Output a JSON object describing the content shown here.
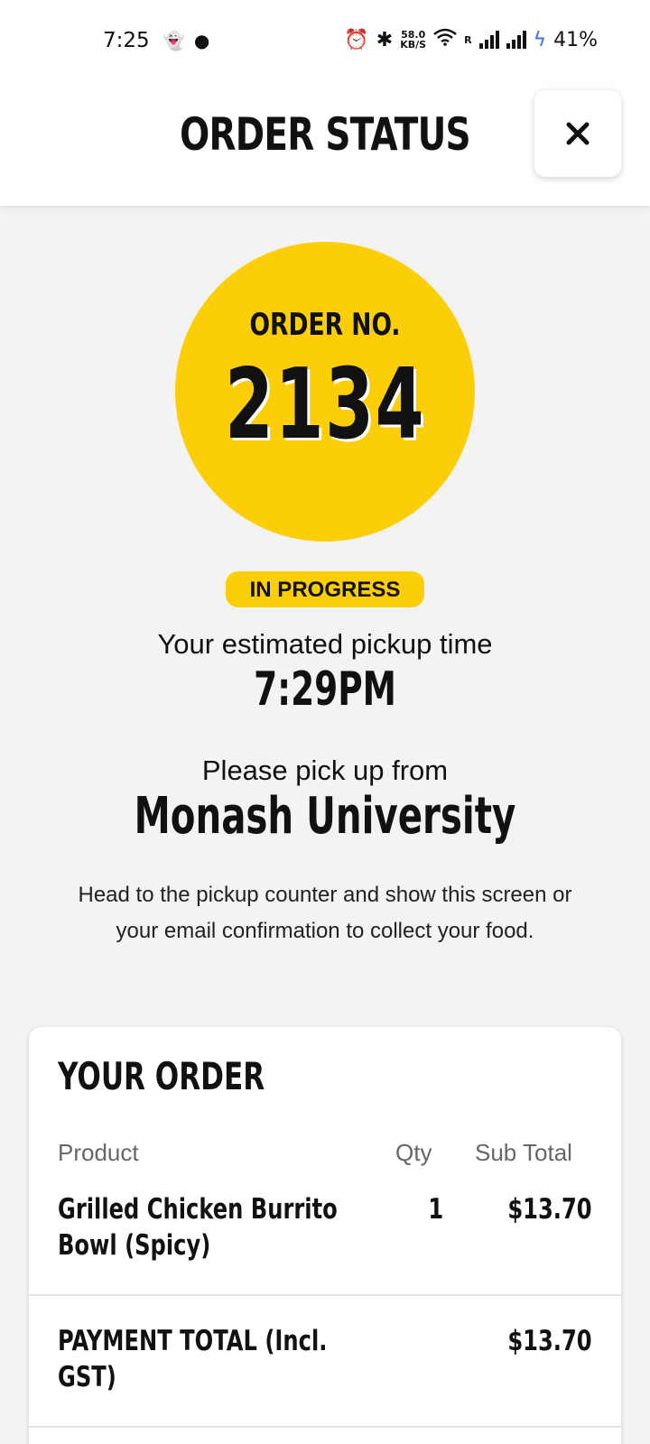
{
  "status_bar": {
    "time": "7:25",
    "notification_icons": [
      "snapchat-icon",
      "reddit-icon"
    ],
    "network_speed_value": "58.0",
    "network_speed_unit": "KB/S",
    "roaming": "R",
    "battery": "41%"
  },
  "header": {
    "title": "ORDER STATUS",
    "close_icon": "close-icon"
  },
  "order": {
    "label": "ORDER NO.",
    "number": "2134",
    "status": "IN PROGRESS",
    "pickup_text": "Your estimated pickup time",
    "pickup_time": "7:29PM",
    "pickup_from_text": "Please pick up from",
    "location": "Monash University",
    "instructions": "Head to the pickup counter and show this screen or your email confirmation to collect your food."
  },
  "summary": {
    "title": "YOUR ORDER",
    "columns": {
      "product": "Product",
      "qty": "Qty",
      "subtotal": "Sub Total"
    },
    "items": [
      {
        "name": "Grilled Chicken Burrito Bowl (Spicy)",
        "qty": "1",
        "subtotal": "$13.70"
      }
    ],
    "total_label": "PAYMENT TOTAL (Incl. GST)",
    "total_value": "$13.70"
  },
  "colors": {
    "accent_yellow": "#fcce07",
    "background": "#f3f3f3",
    "text": "#111111",
    "charging_bolt": "#3d6df2"
  }
}
